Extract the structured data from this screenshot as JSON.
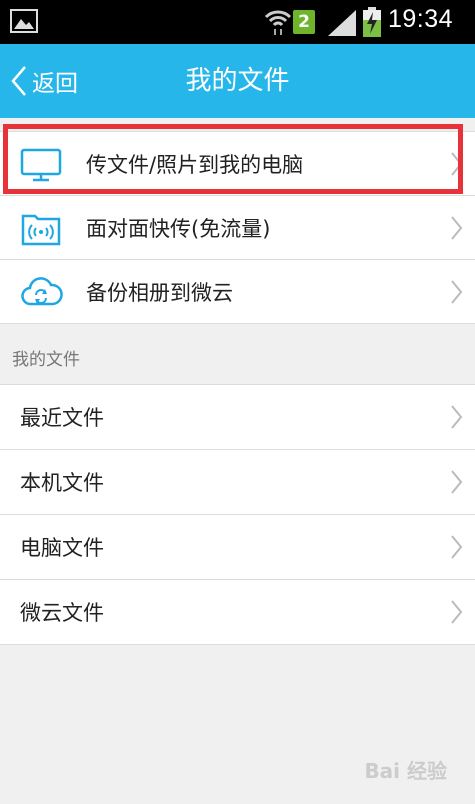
{
  "status_bar": {
    "time": "19:34",
    "notification_badge": "2",
    "icons": [
      "gallery-icon",
      "wifi-icon",
      "signal-icon",
      "battery-charging-icon"
    ]
  },
  "header": {
    "back_label": "返回",
    "title": "我的文件",
    "background_color": "#27b6ea"
  },
  "top_actions": [
    {
      "label": "传文件/照片到我的电脑",
      "icon": "monitor-icon"
    },
    {
      "label": "面对面快传(免流量)",
      "icon": "wireless-folder-icon"
    },
    {
      "label": "备份相册到微云",
      "icon": "cloud-sync-icon"
    }
  ],
  "section": {
    "title": "我的文件",
    "items": [
      {
        "label": "最近文件"
      },
      {
        "label": "本机文件"
      },
      {
        "label": "电脑文件"
      },
      {
        "label": "微云文件"
      }
    ]
  },
  "highlight_color": "#e7323a",
  "watermark": "Bai 经验"
}
